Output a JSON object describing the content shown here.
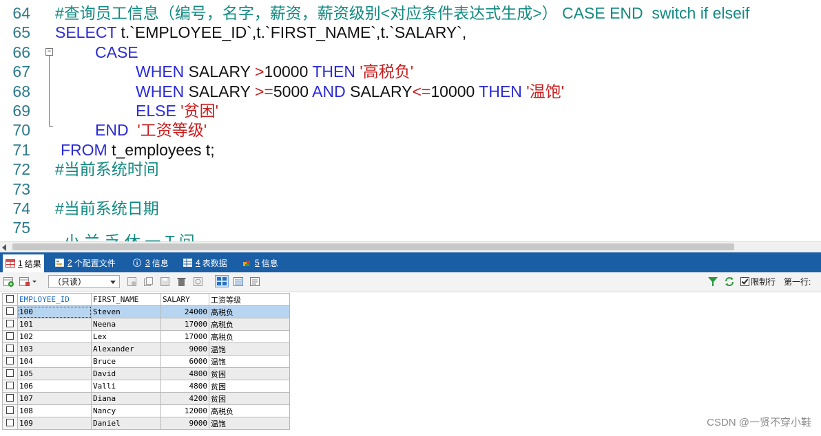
{
  "editor": {
    "lines": [
      {
        "num": "64",
        "indent": 80,
        "tokens": [
          {
            "t": "#查询员工信息（编号，名字，薪资，薪资级别<对应条件表达式生成>） CASE END  switch if elseif",
            "c": "cm"
          }
        ]
      },
      {
        "num": "65",
        "indent": 80,
        "tokens": [
          {
            "t": "SELECT ",
            "c": "kw"
          },
          {
            "t": "t.`EMPLOYEE_ID`,t.`FIRST_NAME`,t.`SALARY`,",
            "c": "tx"
          }
        ]
      },
      {
        "num": "66",
        "indent": 138,
        "tokens": [
          {
            "t": "CASE",
            "c": "kw"
          }
        ]
      },
      {
        "num": "67",
        "indent": 197,
        "tokens": [
          {
            "t": "WHEN ",
            "c": "kw"
          },
          {
            "t": "SALARY ",
            "c": "tx"
          },
          {
            "t": ">",
            "c": "op"
          },
          {
            "t": "10000 ",
            "c": "tx"
          },
          {
            "t": "THEN ",
            "c": "kw"
          },
          {
            "t": "'高税负'",
            "c": "str"
          }
        ]
      },
      {
        "num": "68",
        "indent": 197,
        "tokens": [
          {
            "t": "WHEN ",
            "c": "kw"
          },
          {
            "t": "SALARY ",
            "c": "tx"
          },
          {
            "t": ">=",
            "c": "op"
          },
          {
            "t": "5000 ",
            "c": "tx"
          },
          {
            "t": "AND ",
            "c": "kw"
          },
          {
            "t": "SALARY",
            "c": "tx"
          },
          {
            "t": "<=",
            "c": "op"
          },
          {
            "t": "10000 ",
            "c": "tx"
          },
          {
            "t": "THEN ",
            "c": "kw"
          },
          {
            "t": "'温饱'",
            "c": "str"
          }
        ]
      },
      {
        "num": "69",
        "indent": 197,
        "tokens": [
          {
            "t": "ELSE ",
            "c": "kw"
          },
          {
            "t": "'贫困'",
            "c": "str"
          }
        ]
      },
      {
        "num": "70",
        "indent": 138,
        "tokens": [
          {
            "t": "END  ",
            "c": "kw"
          },
          {
            "t": "'工资等级'",
            "c": "str"
          }
        ]
      },
      {
        "num": "71",
        "indent": 88,
        "tokens": [
          {
            "t": "FROM ",
            "c": "kw"
          },
          {
            "t": "t_employees t;",
            "c": "tx"
          }
        ]
      },
      {
        "num": "72",
        "indent": 80,
        "tokens": [
          {
            "t": "#当前系统时间",
            "c": "cm"
          }
        ]
      },
      {
        "num": "73",
        "indent": 80,
        "tokens": []
      },
      {
        "num": "74",
        "indent": 80,
        "tokens": [
          {
            "t": "#当前系统日期",
            "c": "cm"
          }
        ]
      },
      {
        "num": "75",
        "indent": 80,
        "tokens": []
      }
    ],
    "cutoff_bottom": "  小 兰 乏 休 一 T 问"
  },
  "tabs": [
    {
      "num": "1",
      "label": "结果",
      "icon": "grid-result-icon",
      "active": true
    },
    {
      "num": "2",
      "label": "个配置文件",
      "icon": "profile-icon",
      "active": false
    },
    {
      "num": "3",
      "label": "信息",
      "icon": "info-icon",
      "active": false
    },
    {
      "num": "4",
      "label": "表数据",
      "icon": "table-data-icon",
      "active": false
    },
    {
      "num": "5",
      "label": "信息",
      "icon": "info2-icon",
      "active": false
    }
  ],
  "toolbar": {
    "mode_select_value": "（只读）",
    "limit_label": "限制行",
    "limit_checked": true,
    "first_row_label": "第一行:"
  },
  "grid": {
    "columns": [
      "EMPLOYEE_ID",
      "FIRST_NAME",
      "SALARY",
      "工资等级"
    ],
    "rows": [
      [
        "100",
        "Steven",
        "24000",
        "高税负"
      ],
      [
        "101",
        "Neena",
        "17000",
        "高税负"
      ],
      [
        "102",
        "Lex",
        "17000",
        "高税负"
      ],
      [
        "103",
        "Alexander",
        "9000",
        "温饱"
      ],
      [
        "104",
        "Bruce",
        "6000",
        "温饱"
      ],
      [
        "105",
        "David",
        "4800",
        "贫困"
      ],
      [
        "106",
        "Valli",
        "4800",
        "贫困"
      ],
      [
        "107",
        "Diana",
        "4200",
        "贫困"
      ],
      [
        "108",
        "Nancy",
        "12000",
        "高税负"
      ],
      [
        "109",
        "Daniel",
        "9000",
        "温饱"
      ]
    ],
    "selected_row": 0
  },
  "watermark": "CSDN @一贤不穿小鞋"
}
